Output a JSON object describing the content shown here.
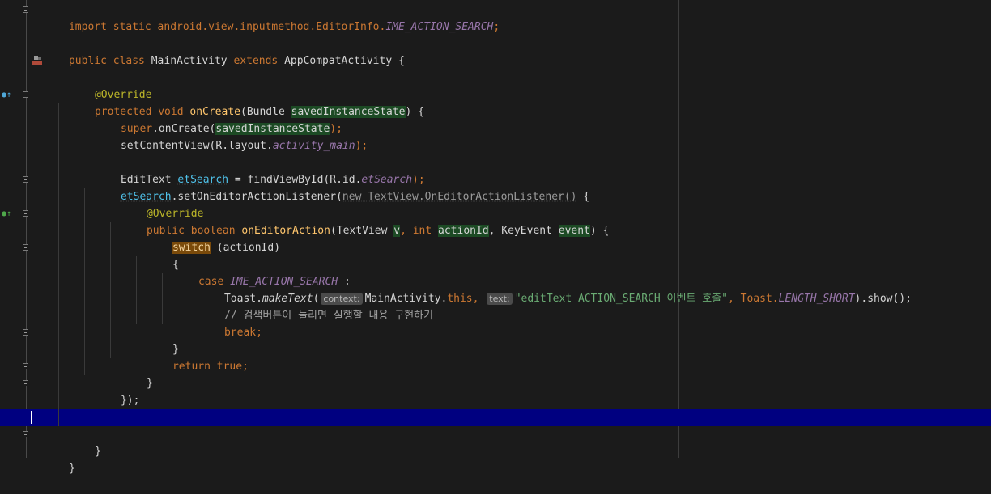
{
  "colors": {
    "background": "#1b1b1b",
    "keyword": "#cc7832",
    "annotation": "#bbb529",
    "method_declaration": "#ffc66d",
    "static_field": "#9876aa",
    "string": "#6a8759",
    "current_line": "#000080"
  },
  "gutter_icons": {
    "class_run": "run-class-icon",
    "override_1": "override-method-icon",
    "override_2": "override-method-icon"
  },
  "code": {
    "l1": {
      "a": "import static android.view.inputmethod.EditorInfo.",
      "b": "IME_ACTION_SEARCH",
      "c": ";"
    },
    "l3": {
      "a": "public class ",
      "b": "MainActivity ",
      "c": "extends ",
      "d": "AppCompatActivity {"
    },
    "l5": {
      "a": "@Override"
    },
    "l6": {
      "a": "protected void ",
      "b": "onCreate",
      "c": "(Bundle ",
      "d": "savedInstanceState",
      "e": ") {"
    },
    "l7": {
      "a": "super",
      "b": ".onCreate(",
      "c": "savedInstanceState",
      "d": ");"
    },
    "l8": {
      "a": "setContentView(R.layout.",
      "b": "activity_main",
      "c": ");"
    },
    "l10": {
      "a": "EditText ",
      "b": "etSearch",
      "c": " = findViewById(R.id.",
      "d": "etSearch",
      "e": ");"
    },
    "l11": {
      "a": "etSearch",
      "b": ".setOnEditorActionListener(",
      "c": "new TextView.OnEditorActionListener()",
      "d": " {"
    },
    "l12": {
      "a": "@Override"
    },
    "l13": {
      "a": "public boolean ",
      "b": "onEditorAction",
      "c": "(TextView ",
      "d": "v",
      "e": ", ",
      "f": "int ",
      "g": "actionId",
      "h": ", KeyEvent ",
      "i": "event",
      "j": ") {"
    },
    "l14": {
      "a": "switch",
      "b": " (actionId)"
    },
    "l15": {
      "a": "{"
    },
    "l16": {
      "a": "case ",
      "b": "IME_ACTION_SEARCH",
      "c": " :"
    },
    "l17": {
      "a": "Toast.",
      "b": "makeText",
      "c": "(",
      "hint1": "context:",
      "d": "MainActivity.",
      "e": "this",
      "f": ", ",
      "hint2": "text:",
      "g": "\"editText ACTION_SEARCH 이벤트 호출\"",
      "h": ", Toast.",
      "i": "LENGTH_SHORT",
      "j": ").show();"
    },
    "l18": {
      "a": "// 검색버튼이 눌리면 실행할 내용 구현하기"
    },
    "l19": {
      "a": "break;"
    },
    "l20": {
      "a": "}"
    },
    "l21": {
      "a": "return ",
      "b": "true;"
    },
    "l22": {
      "a": "}"
    },
    "l23": {
      "a": "});"
    },
    "l26": {
      "a": "}"
    },
    "l27": {
      "a": "}"
    }
  }
}
